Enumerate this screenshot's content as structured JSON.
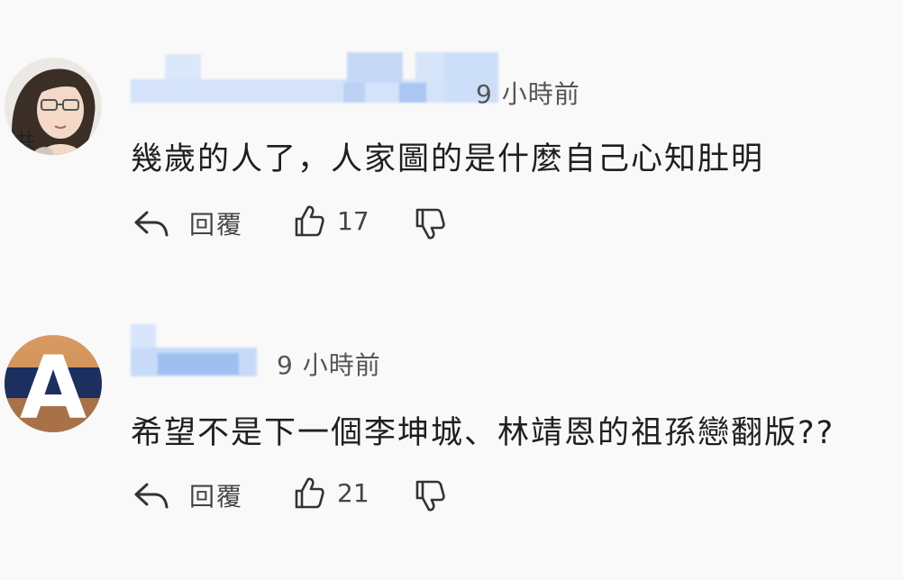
{
  "comments": [
    {
      "avatar_icon": "woman-glasses-avatar",
      "timestamp": "9 小時前",
      "text": "幾歲的人了，人家圖的是什麼自己心知肚明",
      "reply_label": "回覆",
      "like_count": "17"
    },
    {
      "avatar_icon": "letter-a-avatar",
      "avatar_letter": "A",
      "timestamp": "9 小時前",
      "text": "希望不是下一個李坤城、林靖恩的祖孫戀翻版??",
      "reply_label": "回覆",
      "like_count": "21"
    }
  ],
  "colors": {
    "background": "#f9f9f9",
    "username_blur": "#c9dbf7",
    "icon_stroke": "#333333"
  }
}
